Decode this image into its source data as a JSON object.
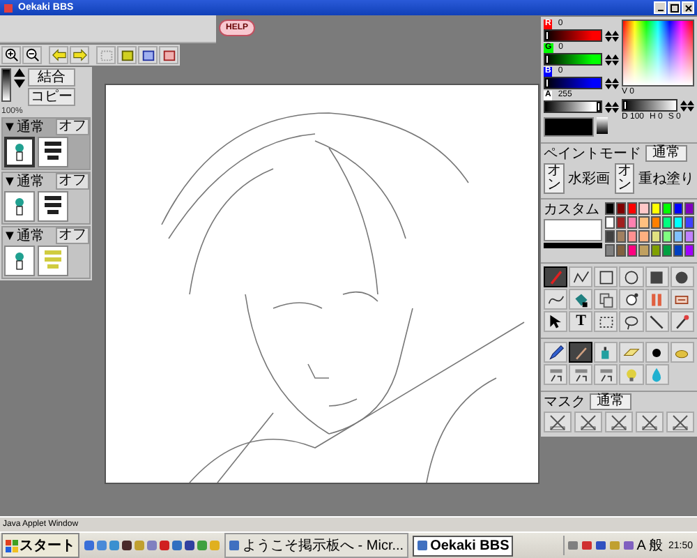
{
  "window": {
    "title": "Oekaki BBS"
  },
  "help": {
    "label": "HELP"
  },
  "layers_panel": {
    "opacity": "100%",
    "level": 1,
    "buttons": [
      "結合",
      "コピー"
    ],
    "layers": [
      {
        "mode": "▼通常",
        "toggle": "オフ",
        "selected": true,
        "color": "#202020"
      },
      {
        "mode": "▼通常",
        "toggle": "オフ",
        "selected": false,
        "color": "#202020"
      },
      {
        "mode": "▼通常",
        "toggle": "オフ",
        "selected": false,
        "color": "#d0cc40"
      }
    ]
  },
  "color_panel": {
    "channels": [
      {
        "name": "R",
        "value": "0",
        "level": 0,
        "color": "#ff0000"
      },
      {
        "name": "G",
        "value": "0",
        "level": 0,
        "color": "#00ff00"
      },
      {
        "name": "B",
        "value": "0",
        "level": 0,
        "color": "#0000ff"
      },
      {
        "name": "A",
        "value": "255",
        "level": 1,
        "color": "#ffffff"
      }
    ],
    "brightness": {
      "label": "V",
      "value": "0",
      "level": 0
    },
    "readout": [
      "D 100",
      "H 0",
      "S 0"
    ]
  },
  "paint_mode": {
    "label": "ペイントモード",
    "mode": "通常",
    "toggles": [
      {
        "on": "オン",
        "name": "水彩画"
      },
      {
        "on": "オン",
        "name": "重ね塗り"
      }
    ]
  },
  "palette": {
    "custom_label": "カスタム",
    "swatches": [
      {
        "color": "#000000"
      },
      {
        "color": "#800000"
      },
      {
        "color": "#ff0000"
      },
      {
        "color": "#ffc8c8"
      },
      {
        "color": "#ffff00"
      },
      {
        "color": "#00ff00"
      },
      {
        "color": "#0000ff"
      },
      {
        "color": "#8000c0"
      },
      {
        "color": "#ffffff"
      },
      {
        "color": "#a02020"
      },
      {
        "color": "#ff80b0"
      },
      {
        "color": "#ffc080"
      },
      {
        "color": "#ff8000"
      },
      {
        "color": "#00ff80"
      },
      {
        "color": "#00ffff"
      },
      {
        "color": "#4040ff"
      },
      {
        "color": "#404040"
      },
      {
        "color": "#a08060"
      },
      {
        "color": "#ff9090"
      },
      {
        "color": "#ffb080"
      },
      {
        "color": "#e0e080"
      },
      {
        "color": "#80ff80"
      },
      {
        "color": "#80c0ff"
      },
      {
        "color": "#c080ff"
      },
      {
        "color": "#808080"
      },
      {
        "color": "#806040"
      },
      {
        "color": "#ff0080"
      },
      {
        "color": "#c0a060"
      },
      {
        "color": "#80a000"
      },
      {
        "color": "#00a040"
      },
      {
        "color": "#0040c0"
      },
      {
        "color": "#a000ff"
      }
    ]
  },
  "tools": [
    {
      "kind": "pen",
      "selected": true
    },
    {
      "kind": "polyline",
      "selected": false
    },
    {
      "kind": "rect",
      "selected": false
    },
    {
      "kind": "ellipse",
      "selected": false
    },
    {
      "kind": "filled-rect",
      "selected": false
    },
    {
      "kind": "filled-ellipse",
      "selected": false
    },
    {
      "kind": "curve",
      "selected": false
    },
    {
      "kind": "bucket",
      "selected": false
    },
    {
      "kind": "copy",
      "selected": false
    },
    {
      "kind": "splash",
      "selected": false
    },
    {
      "kind": "mirror",
      "selected": false
    },
    {
      "kind": "move",
      "selected": false
    },
    {
      "kind": "cursor",
      "selected": false
    },
    {
      "kind": "text",
      "label": "T",
      "selected": false
    },
    {
      "kind": "select",
      "selected": false
    },
    {
      "kind": "lasso",
      "selected": false
    },
    {
      "kind": "line",
      "selected": false
    },
    {
      "kind": "dropper",
      "selected": false
    }
  ],
  "brushes": [
    {
      "kind": "pencil",
      "selected": false
    },
    {
      "kind": "brush",
      "selected": true
    },
    {
      "kind": "airbrush",
      "selected": false
    },
    {
      "kind": "eraser",
      "selected": false
    },
    {
      "kind": "dot",
      "selected": false
    },
    {
      "kind": "smudge",
      "selected": false
    },
    {
      "kind": "timer",
      "selected": false
    },
    {
      "kind": "timer",
      "selected": false
    },
    {
      "kind": "timer",
      "selected": false
    },
    {
      "kind": "bulb",
      "selected": false
    },
    {
      "kind": "drop",
      "selected": false
    }
  ],
  "mask": {
    "label": "マスク",
    "mode": "通常"
  },
  "status_bar": "Java Applet Window",
  "taskbar": {
    "start": "スタート",
    "tasks": [
      {
        "label": "ようこそ掲示板へ - Micr...",
        "selected": false
      },
      {
        "label": "Oekaki BBS",
        "selected": true
      }
    ],
    "ime": [
      "A",
      "般"
    ],
    "clock": "21:50"
  }
}
